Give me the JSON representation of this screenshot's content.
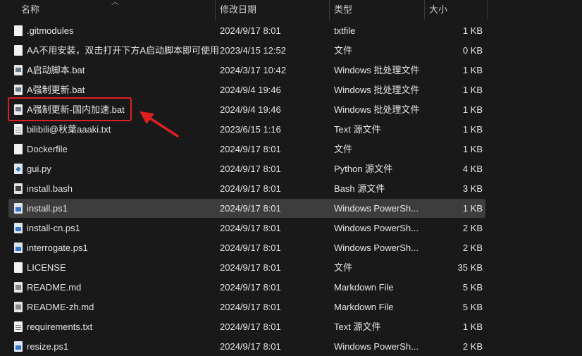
{
  "header": {
    "name_label": "名称",
    "date_label": "修改日期",
    "type_label": "类型",
    "size_label": "大小",
    "sort_icon": "chevron-up-icon"
  },
  "accent": {
    "annotation_color": "#e02020",
    "selected_row_color": "#3d3d3d"
  },
  "files": [
    {
      "name": ".gitmodules",
      "date": "2024/9/17 8:01",
      "type": "txtfile",
      "size": "1 KB",
      "icon": "file-icon"
    },
    {
      "name": "AA不用安装，双击打开下方A启动脚本即可使用",
      "date": "2023/4/15 12:52",
      "type": "文件",
      "size": "0 KB",
      "icon": "file-icon"
    },
    {
      "name": "A启动脚本.bat",
      "date": "2024/3/17 10:42",
      "type": "Windows 批处理文件",
      "size": "1 KB",
      "icon": "batch-file-icon"
    },
    {
      "name": "A强制更新.bat",
      "date": "2024/9/4 19:46",
      "type": "Windows 批处理文件",
      "size": "1 KB",
      "icon": "batch-file-icon"
    },
    {
      "name": "A强制更新-国内加速.bat",
      "date": "2024/9/4 19:46",
      "type": "Windows 批处理文件",
      "size": "1 KB",
      "icon": "batch-file-icon"
    },
    {
      "name": "bilibili@秋葉aaaki.txt",
      "date": "2023/6/15 1:16",
      "type": "Text 源文件",
      "size": "1 KB",
      "icon": "text-file-icon"
    },
    {
      "name": "Dockerfile",
      "date": "2024/9/17 8:01",
      "type": "文件",
      "size": "1 KB",
      "icon": "file-icon"
    },
    {
      "name": "gui.py",
      "date": "2024/9/17 8:01",
      "type": "Python 源文件",
      "size": "4 KB",
      "icon": "python-file-icon"
    },
    {
      "name": "install.bash",
      "date": "2024/9/17 8:01",
      "type": "Bash 源文件",
      "size": "3 KB",
      "icon": "bash-file-icon"
    },
    {
      "name": "install.ps1",
      "date": "2024/9/17 8:01",
      "type": "Windows PowerSh...",
      "size": "1 KB",
      "icon": "powershell-file-icon",
      "selected": true
    },
    {
      "name": "install-cn.ps1",
      "date": "2024/9/17 8:01",
      "type": "Windows PowerSh...",
      "size": "2 KB",
      "icon": "powershell-file-icon"
    },
    {
      "name": "interrogate.ps1",
      "date": "2024/9/17 8:01",
      "type": "Windows PowerSh...",
      "size": "2 KB",
      "icon": "powershell-file-icon"
    },
    {
      "name": "LICENSE",
      "date": "2024/9/17 8:01",
      "type": "文件",
      "size": "35 KB",
      "icon": "file-icon"
    },
    {
      "name": "README.md",
      "date": "2024/9/17 8:01",
      "type": "Markdown File",
      "size": "5 KB",
      "icon": "markdown-file-icon"
    },
    {
      "name": "README-zh.md",
      "date": "2024/9/17 8:01",
      "type": "Markdown File",
      "size": "5 KB",
      "icon": "markdown-file-icon"
    },
    {
      "name": "requirements.txt",
      "date": "2024/9/17 8:01",
      "type": "Text 源文件",
      "size": "1 KB",
      "icon": "text-file-icon"
    },
    {
      "name": "resize.ps1",
      "date": "2024/9/17 8:01",
      "type": "Windows PowerSh...",
      "size": "2 KB",
      "icon": "powershell-file-icon"
    }
  ]
}
